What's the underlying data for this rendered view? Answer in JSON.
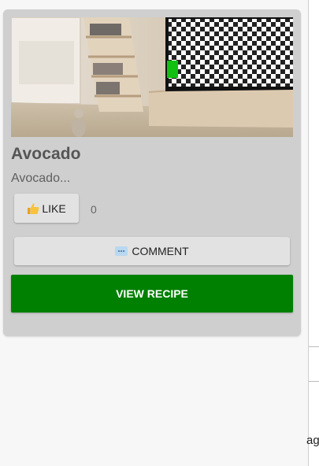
{
  "card": {
    "image": {
      "description_icon": "hero-photo",
      "scene": "room-with-checkerboard-tv"
    },
    "title": "Avocado",
    "description": "Avocado...",
    "like": {
      "icon": "thumbs-up-icon",
      "label": "LIKE",
      "count": "0"
    },
    "comment": {
      "icon": "speech-bubble-icon",
      "label": "COMMENT"
    },
    "view_recipe": {
      "label": "VIEW RECIPE",
      "color": "#008000"
    }
  },
  "background_panel": {
    "clipped_text": "ag"
  },
  "colors": {
    "card_bg": "#cfcfcf",
    "button_bg": "#e2e2e2",
    "accent_green": "#008000"
  }
}
